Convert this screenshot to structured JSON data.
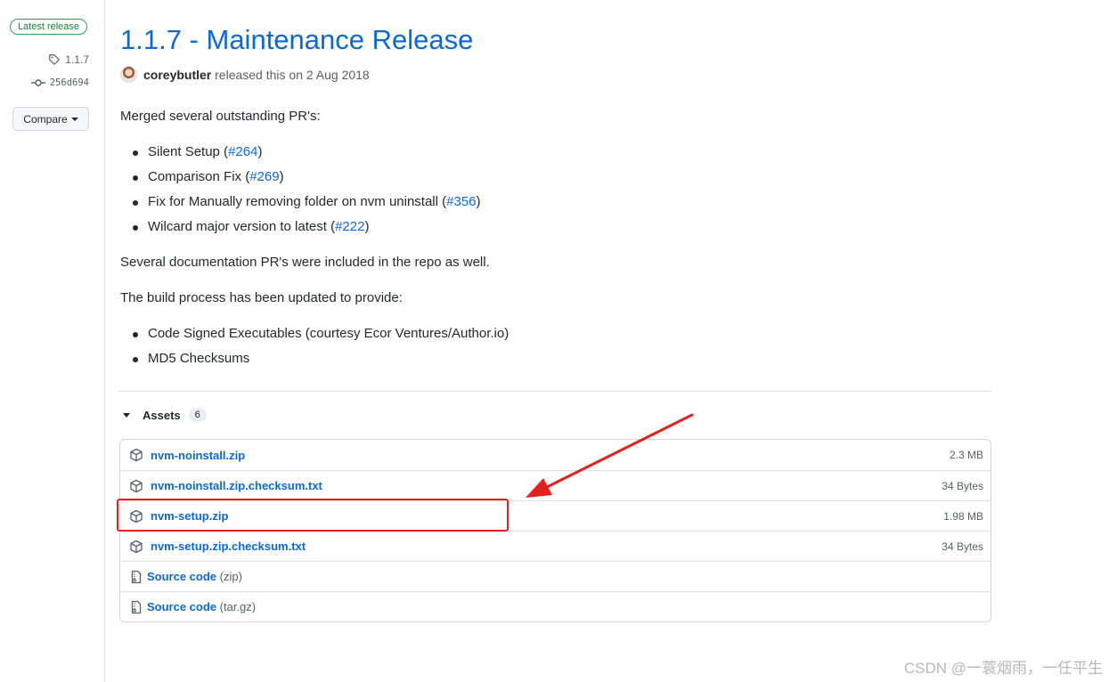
{
  "sidebar": {
    "latest_label": "Latest release",
    "tag": "1.1.7",
    "commit": "256d694",
    "compare_label": "Compare"
  },
  "release": {
    "title": "1.1.7 - Maintenance Release",
    "author": "coreybutler",
    "released_text": "released this on 2 Aug 2018"
  },
  "body": {
    "intro": "Merged several outstanding PR's:",
    "prs": [
      {
        "text": "Silent Setup (",
        "link": "#264",
        "end": ")"
      },
      {
        "text": "Comparison Fix (",
        "link": "#269",
        "end": ")"
      },
      {
        "text": "Fix for Manually removing folder on nvm uninstall (",
        "link": "#356",
        "end": ")"
      },
      {
        "text": "Wilcard major version to latest (",
        "link": "#222",
        "end": ")"
      }
    ],
    "docs_note": "Several documentation PR's were included in the repo as well.",
    "build_intro": "The build process has been updated to provide:",
    "build_items": [
      "Code Signed Executables (courtesy Ecor Ventures/Author.io)",
      "MD5 Checksums"
    ]
  },
  "assets": {
    "label": "Assets",
    "count": "6",
    "files": [
      {
        "name": "nvm-noinstall.zip",
        "size": "2.3 MB"
      },
      {
        "name": "nvm-noinstall.zip.checksum.txt",
        "size": "34 Bytes"
      },
      {
        "name": "nvm-setup.zip",
        "size": "1.98 MB"
      },
      {
        "name": "nvm-setup.zip.checksum.txt",
        "size": "34 Bytes"
      }
    ],
    "source": [
      {
        "name": "Source code",
        "ext": "(zip)"
      },
      {
        "name": "Source code",
        "ext": "(tar.gz)"
      }
    ]
  },
  "annotation": {
    "color": "#e8201d",
    "highlighted_asset": "nvm-setup.zip"
  },
  "watermark": "CSDN @一蓑烟雨，一任平生"
}
